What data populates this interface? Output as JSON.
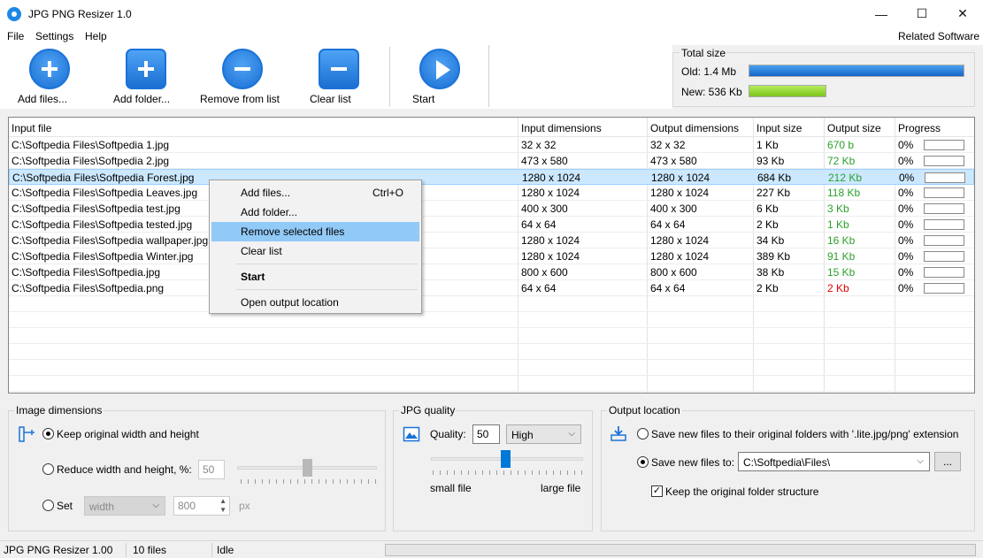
{
  "window": {
    "title": "JPG PNG Resizer 1.0",
    "minimize": "—",
    "maximize": "☐",
    "close": "✕"
  },
  "menu": {
    "file": "File",
    "settings": "Settings",
    "help": "Help",
    "related": "Related Software"
  },
  "toolbar": {
    "add_files": "Add files...",
    "add_folder": "Add folder...",
    "remove": "Remove from list",
    "clear": "Clear list",
    "start": "Start"
  },
  "total_size": {
    "title": "Total size",
    "old_label": "Old: 1.4 Mb",
    "new_label": "New: 536 Kb",
    "old_fill": 1.0,
    "new_fill": 0.36,
    "old_color": "#1a73d9",
    "new_color": "#8fd12a"
  },
  "table": {
    "columns": [
      "Input file",
      "Input dimensions",
      "Output dimensions",
      "Input size",
      "Output size",
      "Progress"
    ],
    "rows": [
      {
        "file": "C:\\Softpedia Files\\Softpedia 1.jpg",
        "in_dim": "32 x 32",
        "out_dim": "32 x 32",
        "in_size": "1 Kb",
        "out_size": "670 b",
        "progress": "0%"
      },
      {
        "file": "C:\\Softpedia Files\\Softpedia 2.jpg",
        "in_dim": "473 x 580",
        "out_dim": "473 x 580",
        "in_size": "93 Kb",
        "out_size": "72 Kb",
        "progress": "0%"
      },
      {
        "file": "C:\\Softpedia Files\\Softpedia Forest.jpg",
        "in_dim": "1280 x 1024",
        "out_dim": "1280 x 1024",
        "in_size": "684 Kb",
        "out_size": "212 Kb",
        "progress": "0%"
      },
      {
        "file": "C:\\Softpedia Files\\Softpedia Leaves.jpg",
        "in_dim": "1280 x 1024",
        "out_dim": "1280 x 1024",
        "in_size": "227 Kb",
        "out_size": "118 Kb",
        "progress": "0%"
      },
      {
        "file": "C:\\Softpedia Files\\Softpedia test.jpg",
        "in_dim": "400 x 300",
        "out_dim": "400 x 300",
        "in_size": "6 Kb",
        "out_size": "3 Kb",
        "progress": "0%"
      },
      {
        "file": "C:\\Softpedia Files\\Softpedia tested.jpg",
        "in_dim": "64 x 64",
        "out_dim": "64 x 64",
        "in_size": "2 Kb",
        "out_size": "1 Kb",
        "progress": "0%"
      },
      {
        "file": "C:\\Softpedia Files\\Softpedia wallpaper.jpg",
        "in_dim": "1280 x 1024",
        "out_dim": "1280 x 1024",
        "in_size": "34 Kb",
        "out_size": "16 Kb",
        "progress": "0%"
      },
      {
        "file": "C:\\Softpedia Files\\Softpedia Winter.jpg",
        "in_dim": "1280 x 1024",
        "out_dim": "1280 x 1024",
        "in_size": "389 Kb",
        "out_size": "91 Kb",
        "progress": "0%"
      },
      {
        "file": "C:\\Softpedia Files\\Softpedia.jpg",
        "in_dim": "800 x 600",
        "out_dim": "800 x 600",
        "in_size": "38 Kb",
        "out_size": "15 Kb",
        "progress": "0%"
      },
      {
        "file": "C:\\Softpedia Files\\Softpedia.png",
        "in_dim": "64 x 64",
        "out_dim": "64 x 64",
        "in_size": "2 Kb",
        "out_size": "2 Kb",
        "progress": "0%"
      }
    ]
  },
  "context_menu": {
    "add_files": "Add files...",
    "add_files_shortcut": "Ctrl+O",
    "add_folder": "Add folder...",
    "remove_selected": "Remove selected files",
    "clear_list": "Clear list",
    "start": "Start",
    "open_output": "Open output location"
  },
  "image_dimensions": {
    "title": "Image dimensions",
    "keep_original": "Keep original width and height",
    "reduce": "Reduce width and height, %:",
    "reduce_value": "50",
    "set": "Set",
    "set_dimension": "width",
    "set_value": "800",
    "unit": "px"
  },
  "jpg_quality": {
    "title": "JPG quality",
    "quality_label": "Quality:",
    "quality_value": "50",
    "preset": "High",
    "small": "small file",
    "large": "large file"
  },
  "output_location": {
    "title": "Output location",
    "original_folders": "Save new files to their original folders with '.lite.jpg/png' extension",
    "save_to": "Save new files to:",
    "path": "C:\\Softpedia\\Files\\",
    "browse": "...",
    "keep_structure": "Keep the original folder structure"
  },
  "status": {
    "app": "JPG PNG Resizer 1.00",
    "count": "10 files",
    "state": "Idle"
  }
}
